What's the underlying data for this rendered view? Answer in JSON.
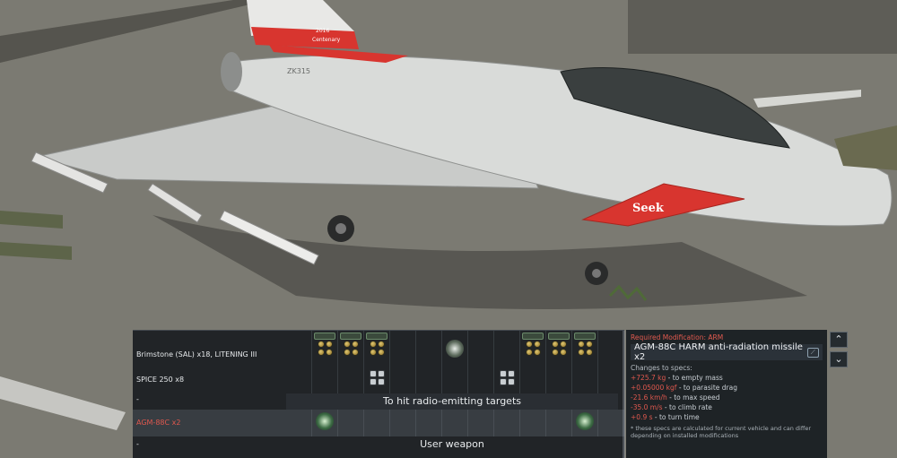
{
  "aircraft": {
    "tail_text_1": "2016",
    "tail_text_2": "Centenary",
    "fuselage_code": "ZK315",
    "nose_fin_text": "Seek"
  },
  "loadout": {
    "rows": [
      {
        "label": "Brimstone (SAL) x18,  LITENING III",
        "highlight": false
      },
      {
        "label": "SPICE 250 x8",
        "highlight": false
      },
      {
        "label": "-",
        "highlight": false
      },
      {
        "label": "AGM-88C x2",
        "highlight": true
      },
      {
        "label": "-",
        "highlight": false
      }
    ],
    "group_titles": [
      "To hit radio-emitting targets",
      "User weapon"
    ]
  },
  "info": {
    "required_mod": "Required Modification: ARM",
    "title": "AGM-88C HARM anti-radiation missile x2",
    "changes_heading": "Changes to specs:",
    "changes": [
      {
        "value": "+725.7 kg",
        "desc": " - to empty mass"
      },
      {
        "value": "+0.05000 kgf",
        "desc": " - to parasite drag"
      },
      {
        "value": "-21.6 km/h",
        "desc": " - to max speed"
      },
      {
        "value": "-35.0 m/s",
        "desc": " - to climb rate"
      },
      {
        "value": "+0.9 s",
        "desc": " - to turn time"
      }
    ],
    "note": "* these specs are calculated for current vehicle and can differ depending on installed modifications"
  },
  "nav": {
    "up": "⌃",
    "down": "⌄"
  },
  "colors": {
    "accent_red": "#e0584e",
    "panel_bg": "#161b20"
  }
}
